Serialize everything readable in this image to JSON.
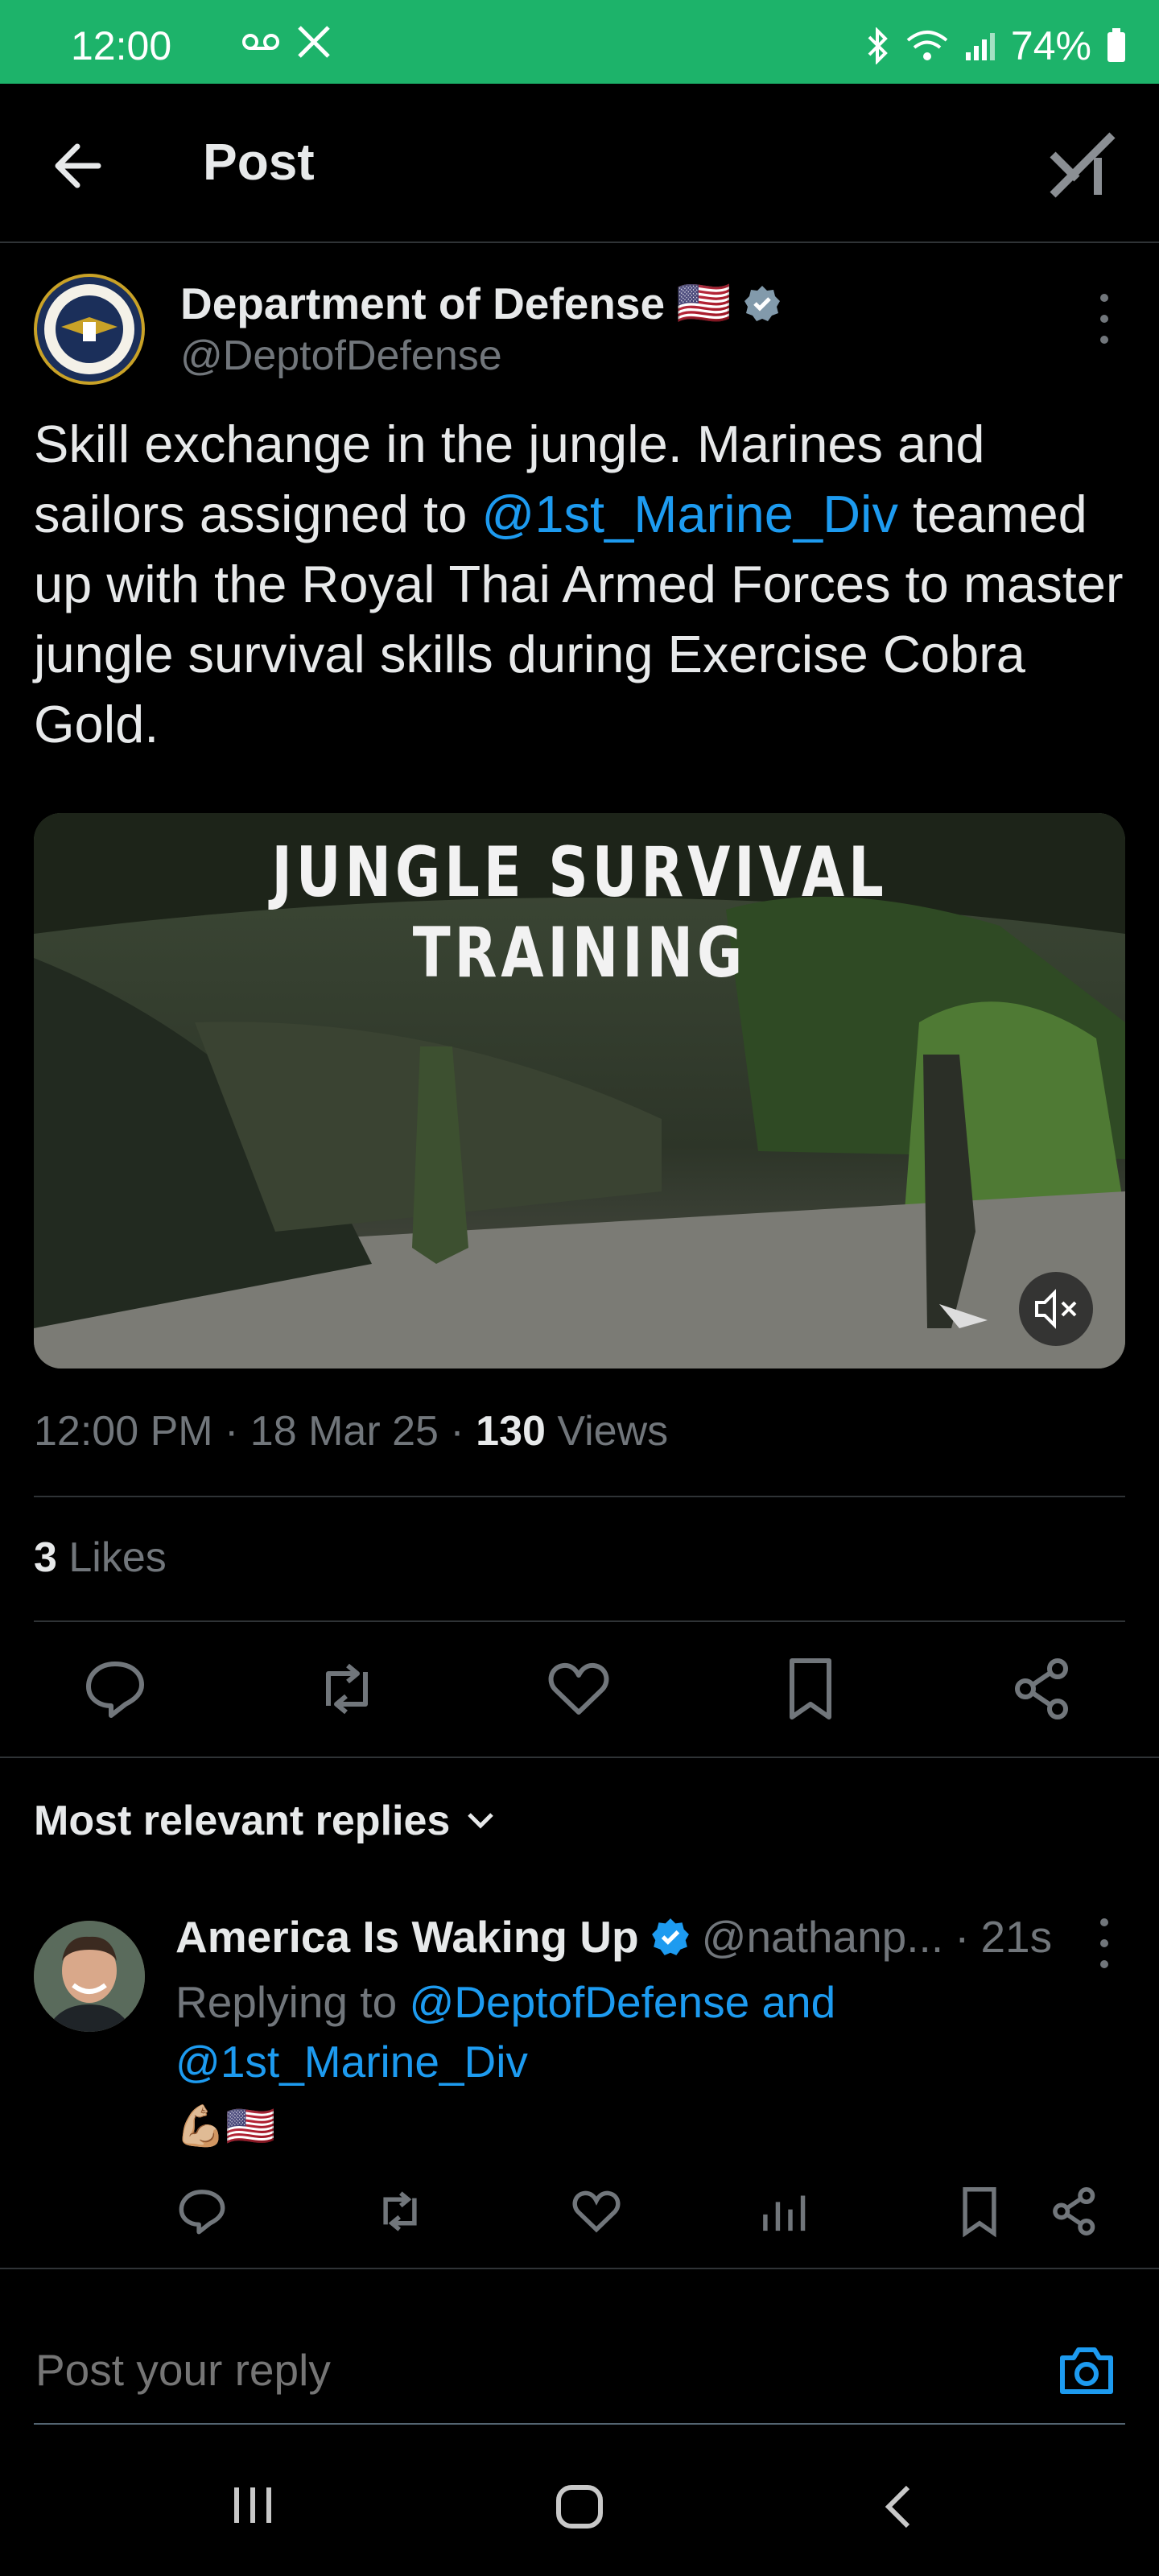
{
  "status_bar": {
    "time": "12:00",
    "left_icons": [
      "voicemail-icon",
      "x-icon"
    ],
    "right_icons": [
      "bluetooth-icon",
      "wifi-icon",
      "signal-icon"
    ],
    "battery": "74%"
  },
  "header": {
    "title": "Post",
    "brand": "grok-icon"
  },
  "post": {
    "author_name": "Department of Defense",
    "author_flag": "🇺🇸",
    "author_handle": "@DeptofDefense",
    "text_1": "Skill exchange in the jungle. Marines and sailors assigned to ",
    "mention": "@1st_Marine_Div",
    "text_2": " teamed up with the Royal Thai Armed Forces to master jungle survival skills during Exercise Cobra Gold.",
    "media_title": "JUNGLE SURVIVAL TRAINING",
    "time": "12:00 PM",
    "date": "18 Mar 25",
    "views_count": "130",
    "views_label": "Views",
    "likes_count": "3",
    "likes_label": "Likes"
  },
  "actions": [
    "reply-icon",
    "repost-icon",
    "like-icon",
    "bookmark-icon",
    "share-icon"
  ],
  "replies": {
    "header": "Most relevant replies",
    "items": [
      {
        "name": "America Is Waking Up",
        "handle": "@nathanp...",
        "time": "21s",
        "replying_prefix": "Replying to ",
        "replying_to": "@DeptofDefense and @1st_Marine_Div",
        "content": "💪🏼🇺🇸"
      }
    ]
  },
  "compose": {
    "placeholder": "Post your reply"
  },
  "colors": {
    "status_bar": "#1db36a",
    "link": "#1d9bf0",
    "muted": "#71767b",
    "text": "#e7e9ea",
    "verified": "#1d9bf0"
  }
}
